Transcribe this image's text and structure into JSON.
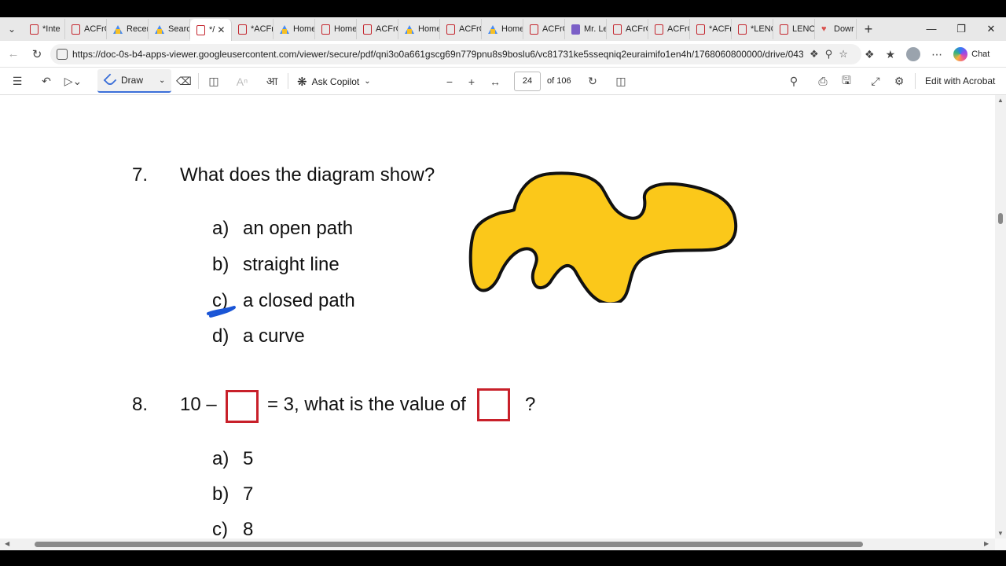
{
  "tabs": [
    {
      "label": "*Inte",
      "icon": "pdf-icon"
    },
    {
      "label": "ACFrC",
      "icon": "pdf-icon"
    },
    {
      "label": "Recer",
      "icon": "drive-icon"
    },
    {
      "label": "Searc",
      "icon": "drive-icon"
    },
    {
      "label": "*/",
      "icon": "pdf-icon",
      "active": true
    },
    {
      "label": "*ACFr",
      "icon": "pdf-icon"
    },
    {
      "label": "Home",
      "icon": "drive-icon"
    },
    {
      "label": "Home",
      "icon": "pdf-icon"
    },
    {
      "label": "ACFrC",
      "icon": "pdf-icon"
    },
    {
      "label": "Home",
      "icon": "drive-icon"
    },
    {
      "label": "ACFrC",
      "icon": "pdf-icon"
    },
    {
      "label": "Home",
      "icon": "drive-icon"
    },
    {
      "label": "ACFrC",
      "icon": "pdf-icon"
    },
    {
      "label": "Mr. Le",
      "icon": "form-icon"
    },
    {
      "label": "ACFrC",
      "icon": "pdf-icon"
    },
    {
      "label": "ACFrC",
      "icon": "pdf-icon"
    },
    {
      "label": "*ACFr",
      "icon": "pdf-icon"
    },
    {
      "label": "*LENC",
      "icon": "pdf-icon"
    },
    {
      "label": "LENO",
      "icon": "pdf-icon"
    },
    {
      "label": "Dowr",
      "icon": "heart-icon"
    }
  ],
  "address": {
    "url": "https://doc-0s-b4-apps-viewer.googleusercontent.com/viewer/secure/pdf/qni3o0a661gscg69n779pnu8s9boslu6/vc81731ke5sseqniq2euraimifo1en4h/1768060800000/drive/043..."
  },
  "browser": {
    "chat_label": "Chat"
  },
  "pdf_toolbar": {
    "draw_label": "Draw",
    "ask_copilot_label": "Ask Copilot",
    "current_page": "24",
    "total_pages": "of 106",
    "edit_label": "Edit with Acrobat"
  },
  "document": {
    "q7": {
      "number": "7.",
      "text": "What does the diagram show?",
      "options": [
        {
          "letter": "a)",
          "text": "an open path"
        },
        {
          "letter": "b)",
          "text": "straight line"
        },
        {
          "letter": "c)",
          "text": "a closed path"
        },
        {
          "letter": "d)",
          "text": "a curve"
        }
      ]
    },
    "q8": {
      "number": "8.",
      "text_start": "10  –",
      "text_mid": "= 3, what is the value of",
      "text_end": "?",
      "options": [
        {
          "letter": "a)",
          "text": "5"
        },
        {
          "letter": "b)",
          "text": "7"
        },
        {
          "letter": "c)",
          "text": "8"
        }
      ]
    },
    "colors": {
      "blob_fill": "#fbc81a",
      "box_border": "#c8202a",
      "ink": "#1a55d6"
    }
  }
}
